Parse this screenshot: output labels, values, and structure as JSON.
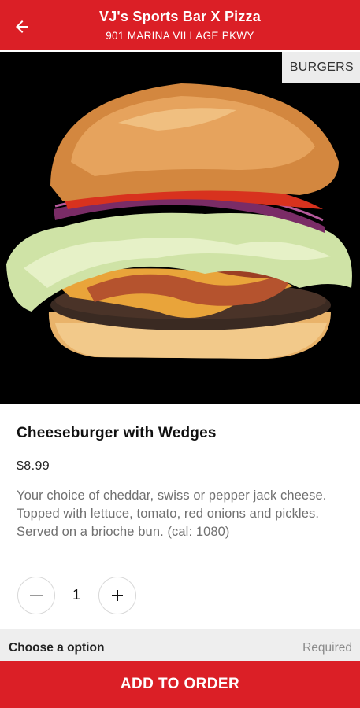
{
  "header": {
    "restaurant_name": "VJ's Sports Bar X Pizza",
    "address": "901 MARINA VILLAGE PKWY",
    "back_icon": "arrow-left-icon",
    "background_color": "#db1f26"
  },
  "hero": {
    "category": "BURGERS",
    "image": "cheeseburger-photo"
  },
  "item": {
    "name": "Cheeseburger with Wedges",
    "price": "$8.99",
    "description": "Your choice of cheddar, swiss or pepper jack cheese. Topped with lettuce, tomato, red onions and pickles. Served on a brioche bun. (cal: 1080)"
  },
  "quantity": {
    "value": "1",
    "minus_icon": "minus-icon",
    "plus_icon": "plus-icon"
  },
  "options": {
    "label": "Choose a option",
    "status": "Required"
  },
  "footer": {
    "add_label": "ADD TO ORDER"
  }
}
